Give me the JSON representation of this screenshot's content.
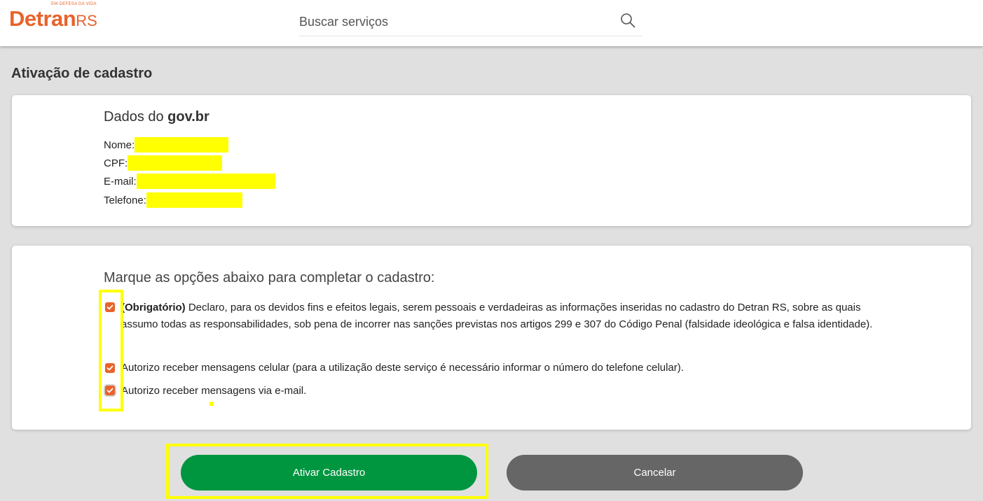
{
  "header": {
    "logo_tagline": "EM DEFESA DA VIDA",
    "logo_main": "Detran",
    "logo_suffix": "RS",
    "search_placeholder": "Buscar serviços",
    "search_icon": "search-icon"
  },
  "page": {
    "title": "Ativação de cadastro"
  },
  "gov_data": {
    "title_prefix": "Dados do ",
    "title_brand": "gov.br",
    "fields": [
      {
        "label": "Nome:",
        "value_redacted": true
      },
      {
        "label": "CPF:",
        "value_redacted": true
      },
      {
        "label": "E-mail:",
        "value_redacted": true
      },
      {
        "label": "Telefone:",
        "value_redacted": true
      }
    ]
  },
  "options": {
    "title": "Marque as opções abaixo para completar o cadastro:",
    "items": [
      {
        "prefix": "(Obrigatório)",
        "text": " Declaro, para os devidos fins e efeitos legais, serem pessoais e verdadeiras as informações inseridas no cadastro do Detran RS, sobre as quais assumo todas as responsabilidades, sob pena de incorrer nas sanções previstas nos artigos 299 e 307 do Código Penal (falsidade ideológica e falsa identidade).",
        "checked": true
      },
      {
        "prefix": "",
        "text": "Autorizo receber mensagens celular (para a utilização deste serviço é necessário informar o número do telefone celular).",
        "checked": true
      },
      {
        "prefix": "",
        "text": "Autorizo receber mensagens via e-mail.",
        "checked": true
      }
    ]
  },
  "actions": {
    "activate_label": "Ativar Cadastro",
    "cancel_label": "Cancelar"
  },
  "colors": {
    "brand_orange": "#e8632b",
    "primary_green": "#009640",
    "secondary_gray": "#666666",
    "highlight_yellow": "#ffff00",
    "page_background": "#e0e0e0"
  }
}
